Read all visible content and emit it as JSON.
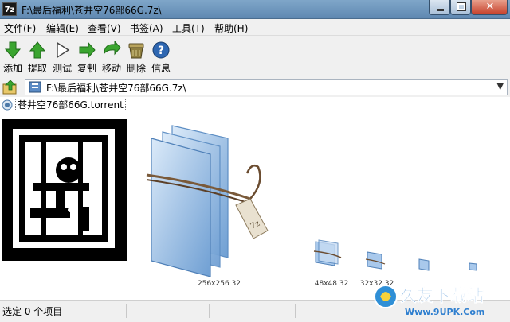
{
  "window": {
    "app_icon": "7z",
    "title": "F:\\最后福利\\苍井空76部66G.7z\\"
  },
  "menu": [
    {
      "label": "文件(F)"
    },
    {
      "label": "编辑(E)"
    },
    {
      "label": "查看(V)"
    },
    {
      "label": "书签(A)"
    },
    {
      "label": "工具(T)"
    },
    {
      "label": "帮助(H)"
    }
  ],
  "toolbar": [
    {
      "label": "添加",
      "icon": "add-icon"
    },
    {
      "label": "提取",
      "icon": "extract-icon"
    },
    {
      "label": "测试",
      "icon": "test-icon"
    },
    {
      "label": "复制",
      "icon": "copy-icon"
    },
    {
      "label": "移动",
      "icon": "move-icon"
    },
    {
      "label": "删除",
      "icon": "delete-icon"
    },
    {
      "label": "信息",
      "icon": "info-icon"
    }
  ],
  "address": {
    "path": "F:\\最后福利\\苍井空76部66G.7z\\"
  },
  "files": [
    {
      "name": "苍井空76部66G.torrent",
      "icon": "torrent-file-icon"
    }
  ],
  "preview": {
    "sizes": [
      "256x256 32",
      "48x48 32",
      "32x32 32"
    ]
  },
  "status": {
    "text": "选定 0 个项目"
  },
  "watermark": {
    "line1": "久友下载站",
    "line2": "Www.9UPK.Com"
  },
  "colors": {
    "titlebar": "#6f97bf",
    "chrome": "#f0f0f0",
    "close": "#c6402a",
    "accent_green": "#3aa52f"
  }
}
